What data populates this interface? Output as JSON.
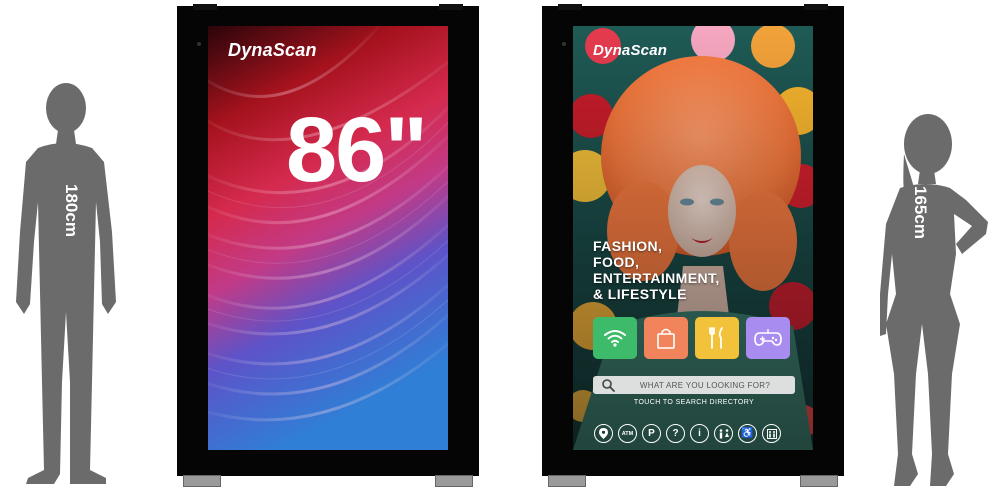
{
  "figures": {
    "left": {
      "height_label": "180cm"
    },
    "right": {
      "height_label": "165cm"
    }
  },
  "left_display": {
    "logo": "DynaScan",
    "size_text": "86\""
  },
  "right_display": {
    "logo": "DynaScan",
    "headline": [
      "FASHION,",
      "FOOD,",
      "ENTERTAINMENT,",
      "& LIFESTYLE"
    ],
    "tiles": [
      {
        "icon": "wifi-icon",
        "color": "#3dbb6a"
      },
      {
        "icon": "shopping-bag-icon",
        "color": "#f2845c"
      },
      {
        "icon": "fork-knife-icon",
        "color": "#f2c23a"
      },
      {
        "icon": "gamepad-icon",
        "color": "#a98cf0"
      }
    ],
    "search_placeholder": "WHAT ARE YOU LOOKING FOR?",
    "search_hint": "TOUCH TO SEARCH DIRECTORY",
    "bottom_icons": [
      {
        "name": "location-pin-icon",
        "glyph": ""
      },
      {
        "name": "atm-icon",
        "glyph": "ATM"
      },
      {
        "name": "parking-icon",
        "glyph": "P"
      },
      {
        "name": "help-icon",
        "glyph": "?"
      },
      {
        "name": "info-icon",
        "glyph": "i"
      },
      {
        "name": "restroom-icon",
        "glyph": ""
      },
      {
        "name": "accessibility-icon",
        "glyph": "♿"
      },
      {
        "name": "elevator-icon",
        "glyph": ""
      }
    ]
  }
}
